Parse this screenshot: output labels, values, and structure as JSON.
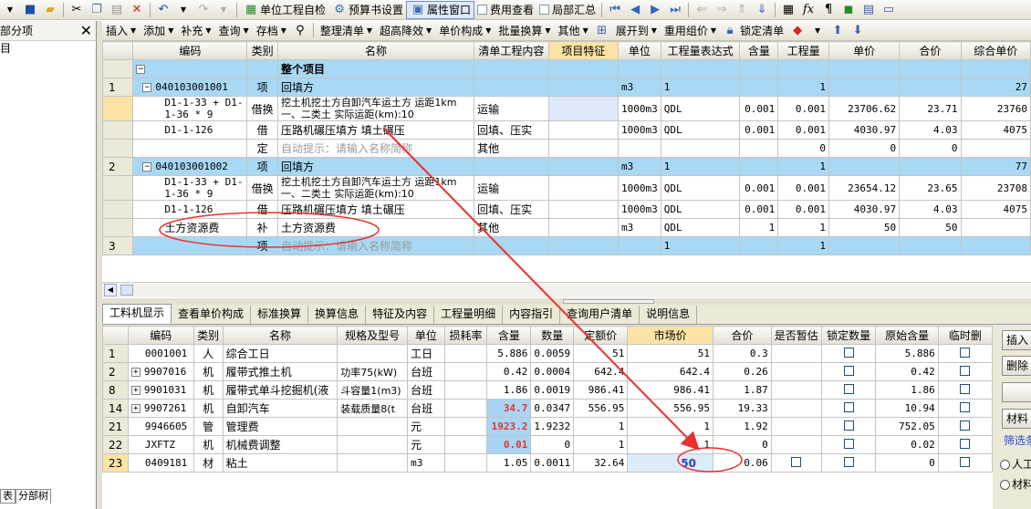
{
  "toolbar1": {
    "items": [
      {
        "label": "单位工程自检",
        "icon": "check-icon"
      },
      {
        "label": "预算书设置",
        "icon": "settings-icon"
      },
      {
        "label": "属性窗口",
        "icon": "window-icon"
      },
      {
        "label": "费用查看",
        "icon": "checkbox"
      },
      {
        "label": "局部汇总",
        "icon": "checkbox"
      }
    ]
  },
  "toolbar2": {
    "left_label": "部分项",
    "items": [
      "插入",
      "添加",
      "补充",
      "查询",
      "存档",
      "整理清单",
      "超高降效",
      "单价构成",
      "批量换算",
      "其他",
      "展开到",
      "重用组价",
      "锁定清单"
    ]
  },
  "left_pane": {
    "title": "部分项",
    "close": "✕",
    "item": "目",
    "tab_a": "表",
    "tab_b": "分部树"
  },
  "upper_table": {
    "headers": [
      "编码",
      "类别",
      "名称",
      "清单工程内容",
      "项目特征",
      "单位",
      "工程量表达式",
      "含量",
      "工程量",
      "单价",
      "合价",
      "综合单价"
    ],
    "rows": [
      {
        "rownum": "",
        "toggle": "−",
        "code": "",
        "type": "",
        "name": "整个项目",
        "content": "",
        "feature": "",
        "unit": "",
        "expr": "",
        "qty_ratio": "",
        "qty": "",
        "price": "",
        "total": "",
        "comp": ""
      },
      {
        "rownum": "1",
        "toggle": "−",
        "code": "040103001001",
        "type": "项",
        "name": "回填方",
        "content": "",
        "feature": "",
        "unit": "m3",
        "expr": "1",
        "qty_ratio": "",
        "qty": "1",
        "price": "",
        "total": "",
        "comp": "27"
      },
      {
        "rownum": "",
        "toggle": "",
        "code": "D1-1-33 + D1-1-36 * 9",
        "type": "借换",
        "name": "挖土机挖土方自卸汽车运土方 运距1km 一、二类土 实际运距(km):10",
        "content": "运输",
        "feature": "",
        "unit": "1000m3",
        "expr": "QDL",
        "qty_ratio": "0.001",
        "qty": "0.001",
        "price": "23706.62",
        "total": "23.71",
        "comp": "23760"
      },
      {
        "rownum": "",
        "toggle": "",
        "code": "D1-1-126",
        "type": "借",
        "name": "压路机碾压填方 填土碾压",
        "content": "回填、压实",
        "feature": "",
        "unit": "1000m3",
        "expr": "QDL",
        "qty_ratio": "0.001",
        "qty": "0.001",
        "price": "4030.97",
        "total": "4.03",
        "comp": "4075"
      },
      {
        "rownum": "",
        "toggle": "",
        "code": "",
        "type": "定",
        "name": "自动提示：请输入名称简称",
        "content": "其他",
        "feature": "",
        "unit": "",
        "expr": "",
        "qty_ratio": "",
        "qty": "0",
        "price": "0",
        "total": "0",
        "comp": ""
      },
      {
        "rownum": "2",
        "toggle": "−",
        "code": "040103001002",
        "type": "项",
        "name": "回填方",
        "content": "",
        "feature": "",
        "unit": "m3",
        "expr": "1",
        "qty_ratio": "",
        "qty": "1",
        "price": "",
        "total": "",
        "comp": "77"
      },
      {
        "rownum": "",
        "toggle": "",
        "code": "D1-1-33 + D1-1-36 * 9",
        "type": "借换",
        "name": "挖土机挖土方自卸汽车运土方 运距1km 一、二类土 实际运距(km):10",
        "content": "运输",
        "feature": "",
        "unit": "1000m3",
        "expr": "QDL",
        "qty_ratio": "0.001",
        "qty": "0.001",
        "price": "23654.12",
        "total": "23.65",
        "comp": "23708"
      },
      {
        "rownum": "",
        "toggle": "",
        "code": "D1-1-126",
        "type": "借",
        "name": "压路机碾压填方 填土碾压",
        "content": "回填、压实",
        "feature": "",
        "unit": "1000m3",
        "expr": "QDL",
        "qty_ratio": "0.001",
        "qty": "0.001",
        "price": "4030.97",
        "total": "4.03",
        "comp": "4075"
      },
      {
        "rownum": "",
        "toggle": "",
        "code": "土方资源费",
        "type": "补",
        "name": "土方资源费",
        "content": "其他",
        "feature": "",
        "unit": "m3",
        "expr": "QDL",
        "qty_ratio": "1",
        "qty": "1",
        "price": "50",
        "total": "50",
        "comp": ""
      },
      {
        "rownum": "3",
        "toggle": "",
        "code": "",
        "type": "项",
        "name": "自动提示：请输入名称简称",
        "content": "",
        "feature": "",
        "unit": "",
        "expr": "1",
        "qty_ratio": "",
        "qty": "1",
        "price": "",
        "total": "",
        "comp": ""
      }
    ]
  },
  "tabs": [
    "工料机显示",
    "查看单价构成",
    "标准换算",
    "换算信息",
    "特征及内容",
    "工程量明细",
    "内容指引",
    "查询用户清单",
    "说明信息"
  ],
  "lower_table": {
    "headers": [
      "编码",
      "类别",
      "名称",
      "规格及型号",
      "单位",
      "损耗率",
      "含量",
      "数量",
      "定额价",
      "市场价",
      "合价",
      "是否暂估",
      "锁定数量",
      "原始含量",
      "临时删"
    ],
    "rows": [
      {
        "rownum": "1",
        "expand": "",
        "code": "0001001",
        "type": "人",
        "name": "综合工日",
        "spec": "",
        "unit": "工日",
        "loss": "",
        "ratio": "5.886",
        "qty": "0.0059",
        "fixed": "51",
        "market": "51",
        "total": "0.3",
        "est": "",
        "lock": "☐",
        "orig": "5.886",
        "del": "☐"
      },
      {
        "rownum": "2",
        "expand": "+",
        "code": "9907016",
        "type": "机",
        "name": "履带式推土机",
        "spec": "功率75(kW)",
        "unit": "台班",
        "loss": "",
        "ratio": "0.42",
        "qty": "0.0004",
        "fixed": "642.4",
        "market": "642.4",
        "total": "0.26",
        "est": "",
        "lock": "☐",
        "orig": "0.42",
        "del": "☐"
      },
      {
        "rownum": "8",
        "expand": "+",
        "code": "9901031",
        "type": "机",
        "name": "履带式单斗挖掘机(液",
        "spec": "斗容量1(m3)",
        "unit": "台班",
        "loss": "",
        "ratio": "1.86",
        "qty": "0.0019",
        "fixed": "986.41",
        "market": "986.41",
        "total": "1.87",
        "est": "",
        "lock": "☐",
        "orig": "1.86",
        "del": "☐"
      },
      {
        "rownum": "14",
        "expand": "+",
        "code": "9907261",
        "type": "机",
        "name": "自卸汽车",
        "spec": "装载质量8(t",
        "unit": "台班",
        "loss": "",
        "ratio": "34.7",
        "qty": "0.0347",
        "fixed": "556.95",
        "market": "556.95",
        "total": "19.33",
        "est": "",
        "lock": "☐",
        "orig": "10.94",
        "del": "☐"
      },
      {
        "rownum": "21",
        "expand": "",
        "code": "9946605",
        "type": "管",
        "name": "管理费",
        "spec": "",
        "unit": "元",
        "loss": "",
        "ratio": "1923.2",
        "qty": "1.9232",
        "fixed": "1",
        "market": "1",
        "total": "1.92",
        "est": "",
        "lock": "☐",
        "orig": "752.05",
        "del": "☐"
      },
      {
        "rownum": "22",
        "expand": "",
        "code": "JXFTZ",
        "type": "机",
        "name": "机械费调整",
        "spec": "",
        "unit": "元",
        "loss": "",
        "ratio": "0.01",
        "qty": "0",
        "fixed": "1",
        "market": "1",
        "total": "0",
        "est": "",
        "lock": "☐",
        "orig": "0.02",
        "del": "☐"
      },
      {
        "rownum": "23",
        "expand": "",
        "code": "0409181",
        "type": "材",
        "name": "粘土",
        "spec": "",
        "unit": "m3",
        "loss": "",
        "ratio": "1.05",
        "qty": "0.0011",
        "fixed": "32.64",
        "market": "50",
        "total": "0.06",
        "est": "☐",
        "lock": "☐",
        "orig": "0",
        "del": "☐"
      }
    ]
  },
  "right_panel": {
    "btn_insert": "插入",
    "btn_delete": "删除",
    "btn_material": "材料",
    "filter_label": "筛选条",
    "radio_labor": "人工",
    "radio_material": "材料"
  },
  "annotation_colors": {
    "arrow": "#e8322e",
    "ellipse": "#e8322e"
  }
}
